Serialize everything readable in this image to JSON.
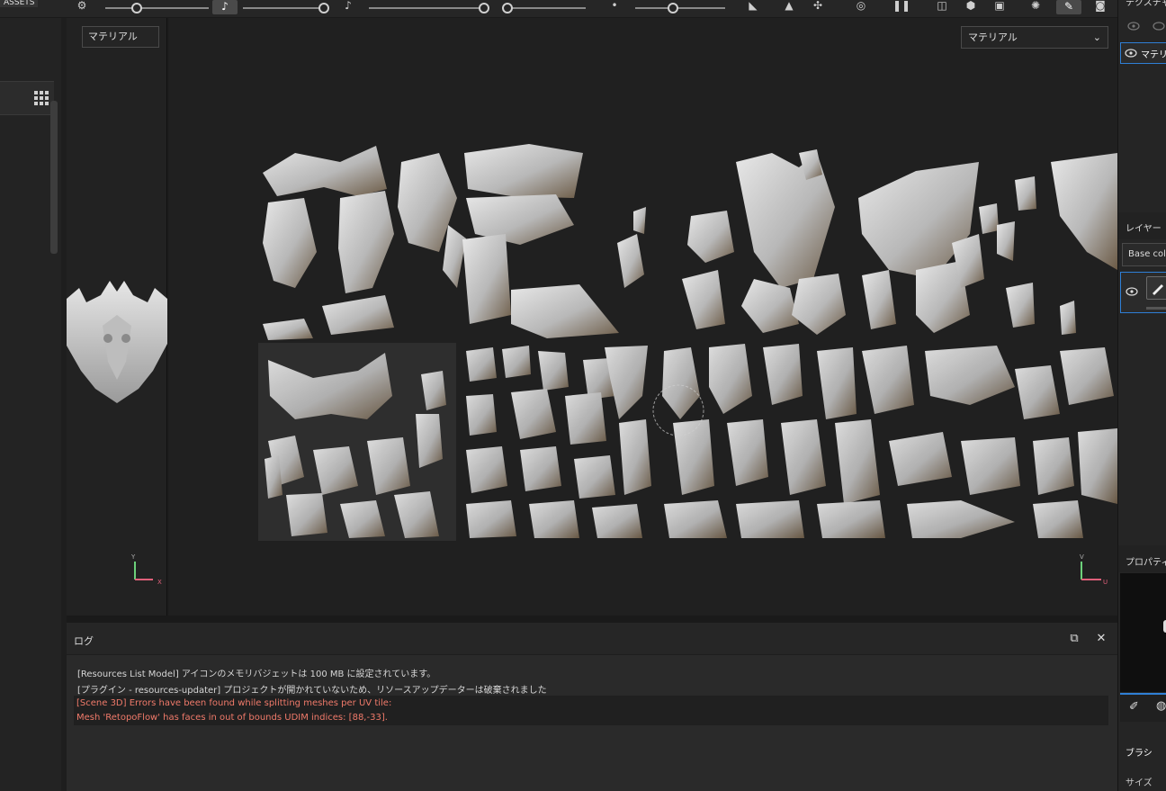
{
  "toolbar": {
    "assets_tab": "ASSETS"
  },
  "views": {
    "material_select_small": "マテリアル",
    "material_select_right": "マテリアル"
  },
  "axes": {
    "left_x": "X",
    "left_y": "Y",
    "right_u": "U",
    "right_v": "V"
  },
  "log": {
    "title": "ログ",
    "lines": [
      "[Resources List Model] アイコンのメモリバジェットは 100 MB に設定されています。",
      "[プラグイン - resources-updater] プロジェクトが開かれていないため、リソースアップデーターは破棄されました"
    ],
    "error_lines": [
      "[Scene 3D] Errors have been found while splitting meshes per UV tile:",
      "Mesh 'RetopoFlow' has faces in out of bounds UDIM indices: [88,-33]."
    ]
  },
  "right_panel": {
    "texture_set_tab": "テクスチャセ",
    "material_row": "マテリア",
    "layers_tab": "レイヤー",
    "base_color": "Base colo",
    "properties_tab": "プロパティ",
    "brush_label": "ブラシ",
    "size_label": "サイズ"
  },
  "colors": {
    "accent": "#2f7fd6",
    "error": "#f07a6a",
    "panel": "#2a2a2a",
    "viewport": "#202020"
  }
}
